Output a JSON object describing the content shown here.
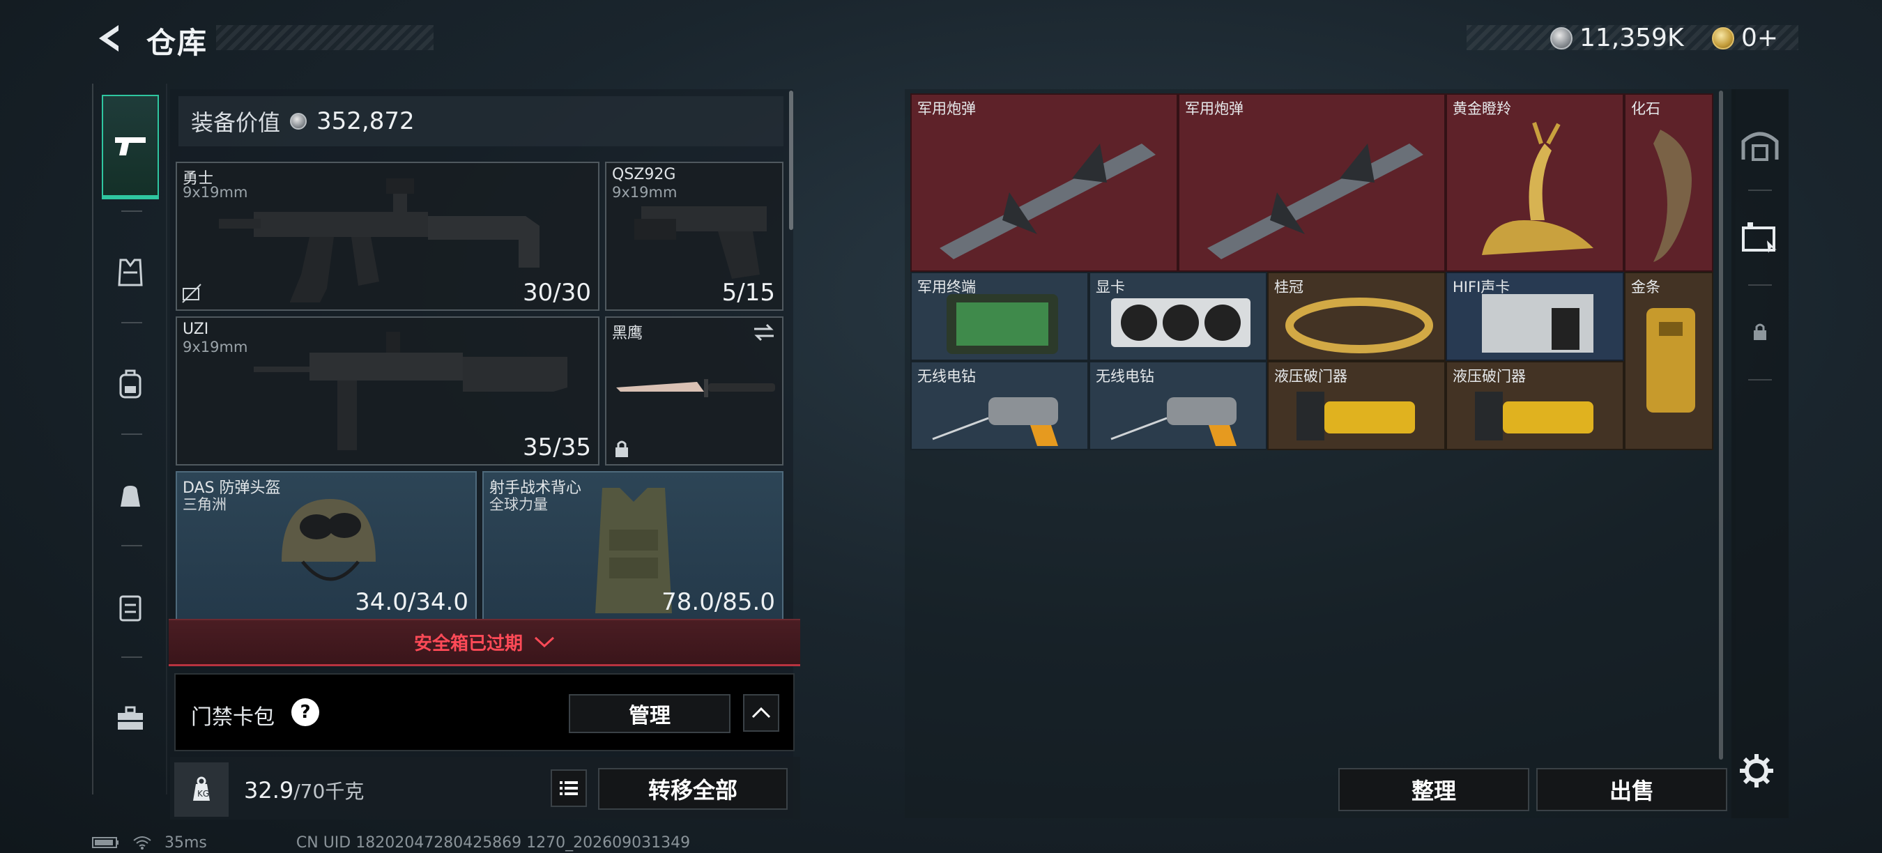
{
  "header": {
    "title": "仓库"
  },
  "currency": {
    "coins": "11,359K",
    "premium": "0+"
  },
  "equipment": {
    "value_label": "装备价值",
    "value": "352,872",
    "slots": [
      {
        "name": "勇士",
        "sub": "9x19mm",
        "count": "30/30"
      },
      {
        "name": "QSZ92G",
        "sub": "9x19mm",
        "count": "5/15"
      },
      {
        "name": "UZI",
        "sub": "9x19mm",
        "count": "35/35"
      },
      {
        "name": "黑鹰",
        "sub": "",
        "count": ""
      },
      {
        "name": "DAS 防弹头盔",
        "sub": "三角洲",
        "count": "34.0/34.0"
      },
      {
        "name": "射手战术背心",
        "sub": "全球力量",
        "count": "78.0/85.0"
      }
    ]
  },
  "safe_box": {
    "label": "安全箱已过期"
  },
  "card_pack": {
    "label": "门禁卡包",
    "help": "?",
    "manage": "管理"
  },
  "weight": {
    "current": "32.9",
    "max": "/70千克"
  },
  "transfer_all": "转移全部",
  "stash": {
    "items": [
      {
        "name": "军用炮弹"
      },
      {
        "name": "军用炮弹"
      },
      {
        "name": "黄金瞪羚"
      },
      {
        "name": "化石"
      },
      {
        "name": "军用终端"
      },
      {
        "name": "显卡"
      },
      {
        "name": "桂冠"
      },
      {
        "name": "HIFI声卡"
      },
      {
        "name": "金条"
      },
      {
        "name": "无线电钻"
      },
      {
        "name": "无线电钻"
      },
      {
        "name": "液压破门器"
      },
      {
        "name": "液压破门器"
      }
    ],
    "colors": {
      "red": "#5e2229",
      "brown": "#433324",
      "navy": "#283a52",
      "slate": "#2b3c4c"
    }
  },
  "actions": {
    "sort": "整理",
    "sell": "出售"
  },
  "status": {
    "ping": "35ms",
    "uid": "CN UID 18202047280425869 1270_202609031349"
  }
}
